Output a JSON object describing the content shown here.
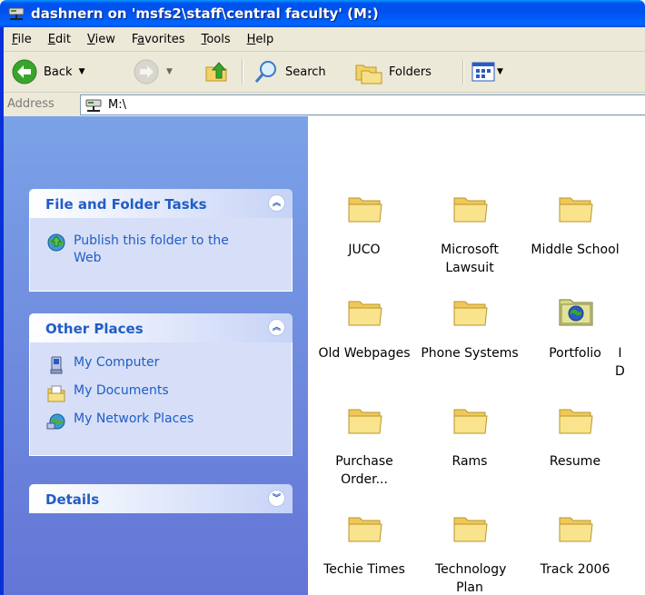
{
  "window": {
    "title": "dashnern on 'msfs2\\staff\\central faculty' (M:)"
  },
  "menu": {
    "items": [
      {
        "ul": "F",
        "rest": "ile"
      },
      {
        "ul": "E",
        "rest": "dit"
      },
      {
        "ul": "V",
        "rest": "iew"
      },
      {
        "pre": "F",
        "ul": "a",
        "rest": "vorites"
      },
      {
        "ul": "T",
        "rest": "ools"
      },
      {
        "ul": "H",
        "rest": "elp"
      }
    ]
  },
  "toolbar": {
    "back_label": "Back",
    "search_label": "Search",
    "folders_label": "Folders"
  },
  "address": {
    "label": "Address",
    "value": "M:\\"
  },
  "tasks": {
    "file_folder": {
      "title": "File and Folder Tasks",
      "items": [
        "Publish this folder to the Web"
      ]
    },
    "other_places": {
      "title": "Other Places",
      "items": [
        "My Computer",
        "My Documents",
        "My Network Places"
      ]
    },
    "details": {
      "title": "Details"
    }
  },
  "files": [
    {
      "name": "JUCO"
    },
    {
      "name": "Microsoft Lawsuit"
    },
    {
      "name": "Middle School"
    },
    {
      "name": "Old Webpages"
    },
    {
      "name": "Phone Systems"
    },
    {
      "name": "Portfolio"
    },
    {
      "name": "Purchase Order..."
    },
    {
      "name": "Rams"
    },
    {
      "name": "Resume"
    },
    {
      "name": "Techie Times"
    },
    {
      "name": "Technology Plan"
    },
    {
      "name": "Track 2006"
    },
    {
      "name": "D"
    }
  ],
  "colors": {
    "titlebar": "#0055ea",
    "taskpane": "#7ba2e7",
    "link": "#215dc6",
    "folder": "#f9e38d"
  }
}
